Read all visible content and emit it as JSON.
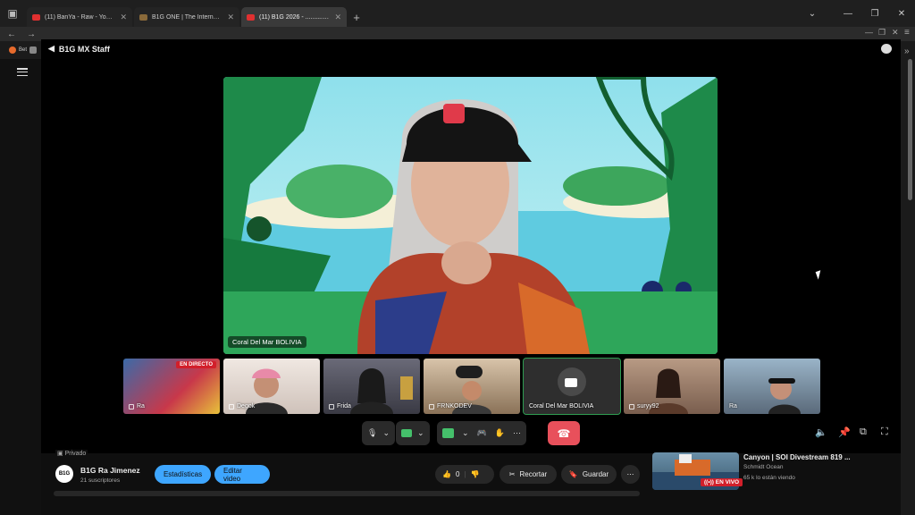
{
  "browser": {
    "tabs": [
      {
        "title": "(11) BanYa - Raw - YouTube",
        "favicon_color": "#e03030"
      },
      {
        "title": "B1G ONE | The International Pu",
        "favicon_color": "#8a6a3a"
      },
      {
        "title": "(11) B1G 2026 - .................",
        "favicon_color": "#e03030"
      }
    ],
    "bookmark_label": "Bet"
  },
  "meeting": {
    "title": "B1G MX Staff",
    "main_speaker": "Coral Del Mar BOLIVIA",
    "participants": [
      {
        "name": "Ra",
        "live_badge": "EN DIRECTO",
        "bg": "#3b6aa8"
      },
      {
        "name": "Degok",
        "bg": "#e2d8d2"
      },
      {
        "name": "Frida",
        "bg": "#8a8a92"
      },
      {
        "name": "FRNKODEV",
        "bg": "#bfa68a"
      },
      {
        "name": "Coral Del Mar BOLIVIA",
        "bg": "#3a3a3a"
      },
      {
        "name": "suryy92",
        "bg": "#a68a78"
      },
      {
        "name": "Ra",
        "bg": "#8aa4b8"
      }
    ],
    "controls": {
      "mic_icon": "microphone-icon",
      "cam_icon": "camera-icon",
      "share_icon": "present-screen-icon",
      "hangup_color": "#e8505b",
      "active_color": "#45c06b"
    }
  },
  "youtube": {
    "privacy": "Privado",
    "channel_name": "B1G Ra Jimenez",
    "channel_logo": "B1G",
    "subscribers": "21 suscriptores",
    "stats_button": "Estadísticas",
    "edit_button": "Editar video",
    "likes": "0",
    "clip_label": "Recortar",
    "save_label": "Guardar",
    "recommended": {
      "title": "Canyon | SOI Divestream 819 ...",
      "channel": "Schmidt Ocean",
      "viewers": "65 k lo están viendo",
      "live_label": "EN VIVO"
    }
  }
}
